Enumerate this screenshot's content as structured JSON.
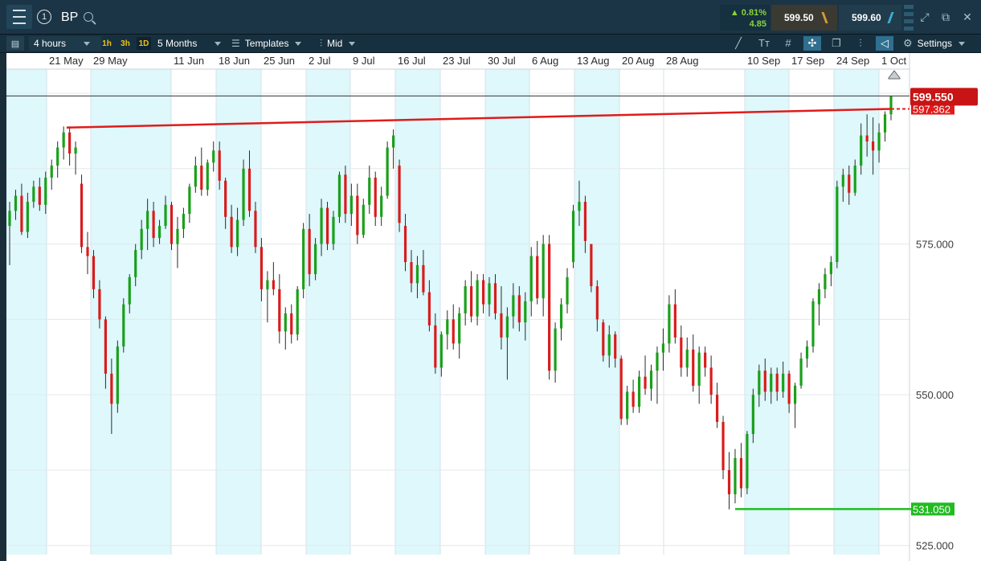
{
  "header": {
    "symbol": "BP",
    "instrument_count": "1",
    "change_pct": "▲ 0.81%",
    "change_abs": "4.85",
    "sell_price": "599.50",
    "buy_price": "599.60"
  },
  "toolbar": {
    "interval": "4 hours",
    "quick_intervals": [
      "1h",
      "3h",
      "1D"
    ],
    "range": "5 Months",
    "templates_label": "Templates",
    "price_mode": "Mid",
    "settings_label": "Settings"
  },
  "colors": {
    "up": "#1aa01a",
    "down": "#d91c1c",
    "band": "#def8fc",
    "topbar": "#1b3546"
  },
  "chart_data": {
    "type": "candlestick",
    "x_ticks": [
      "21 May",
      "29 May",
      "11 Jun",
      "18 Jun",
      "25 Jun",
      "2 Jul",
      "9 Jul",
      "16 Jul",
      "23 Jul",
      "30 Jul",
      "6 Aug",
      "13 Aug",
      "20 Aug",
      "28 Aug",
      "10 Sep",
      "17 Sep",
      "24 Sep",
      "1 Oct"
    ],
    "y_ticks": [
      575,
      550,
      525
    ],
    "y_tick_labels": [
      "575.000",
      "550.000",
      "525.000"
    ],
    "ylim": [
      523.5,
      604
    ],
    "current_price_label": "599.550",
    "resistance_label": "597.362",
    "support_label": "531.050",
    "resistance_line": {
      "from": {
        "x": "~18 May",
        "y": 594.3
      },
      "to": {
        "x": "1 Oct",
        "y": 597.4
      }
    },
    "support_line": {
      "from": "~7 Sep",
      "to": "1 Oct",
      "y": 531.05
    },
    "candles": [
      [
        578.0,
        582.0,
        571.5,
        580.5
      ],
      [
        580.5,
        584.0,
        579.0,
        583.0
      ],
      [
        583.0,
        585.0,
        576.5,
        577.0
      ],
      [
        577.0,
        583.5,
        576.0,
        582.0
      ],
      [
        582.0,
        585.5,
        581.0,
        584.5
      ],
      [
        584.5,
        586.0,
        580.5,
        581.5
      ],
      [
        581.5,
        587.0,
        580.0,
        586.0
      ],
      [
        586.0,
        589.0,
        584.0,
        588.0
      ],
      [
        588.0,
        592.0,
        586.0,
        591.0
      ],
      [
        591.0,
        594.5,
        589.0,
        593.5
      ],
      [
        593.5,
        594.5,
        588.0,
        590.0
      ],
      [
        590.0,
        592.0,
        586.5,
        591.0
      ],
      [
        585.0,
        586.5,
        573.5,
        574.5
      ],
      [
        574.5,
        577.0,
        570.0,
        573.0
      ],
      [
        573.0,
        574.0,
        566.0,
        567.5
      ],
      [
        567.5,
        569.0,
        561.0,
        562.5
      ],
      [
        562.5,
        563.0,
        551.0,
        553.5
      ],
      [
        553.5,
        556.0,
        543.5,
        548.5
      ],
      [
        548.5,
        559.0,
        547.0,
        558.0
      ],
      [
        558.0,
        566.0,
        557.0,
        565.0
      ],
      [
        565.0,
        570.0,
        563.5,
        569.5
      ],
      [
        569.5,
        575.0,
        568.0,
        574.0
      ],
      [
        574.0,
        579.0,
        572.5,
        577.5
      ],
      [
        577.5,
        582.5,
        574.0,
        580.5
      ],
      [
        580.5,
        582.0,
        574.5,
        576.0
      ],
      [
        576.0,
        579.0,
        575.0,
        578.0
      ],
      [
        578.0,
        583.0,
        577.5,
        581.5
      ],
      [
        581.5,
        582.0,
        574.0,
        575.0
      ],
      [
        575.0,
        579.5,
        571.0,
        577.5
      ],
      [
        577.5,
        581.0,
        576.0,
        580.0
      ],
      [
        580.0,
        585.0,
        578.5,
        584.5
      ],
      [
        584.5,
        589.5,
        583.5,
        588.0
      ],
      [
        588.0,
        591.0,
        583.0,
        584.0
      ],
      [
        584.0,
        589.0,
        583.0,
        588.5
      ],
      [
        588.5,
        592.0,
        587.0,
        590.5
      ],
      [
        590.5,
        592.0,
        584.0,
        585.5
      ],
      [
        585.5,
        586.0,
        577.5,
        579.5
      ],
      [
        579.5,
        581.5,
        573.5,
        574.5
      ],
      [
        574.5,
        581.0,
        573.0,
        579.0
      ],
      [
        579.0,
        589.0,
        578.0,
        587.5
      ],
      [
        587.5,
        590.5,
        579.5,
        580.5
      ],
      [
        580.5,
        582.0,
        573.5,
        574.5
      ],
      [
        574.5,
        576.0,
        565.5,
        567.5
      ],
      [
        567.5,
        570.5,
        562.0,
        569.0
      ],
      [
        569.0,
        572.0,
        566.5,
        567.5
      ],
      [
        567.5,
        570.0,
        558.5,
        560.5
      ],
      [
        560.5,
        564.5,
        557.5,
        563.5
      ],
      [
        563.5,
        565.0,
        558.5,
        560.0
      ],
      [
        560.0,
        568.0,
        559.0,
        567.5
      ],
      [
        567.5,
        578.5,
        566.0,
        577.5
      ],
      [
        577.5,
        580.0,
        568.0,
        570.0
      ],
      [
        570.0,
        576.0,
        569.0,
        575.0
      ],
      [
        575.0,
        582.5,
        573.0,
        581.0
      ],
      [
        581.0,
        582.0,
        574.0,
        575.0
      ],
      [
        575.0,
        580.5,
        574.0,
        579.5
      ],
      [
        579.5,
        587.0,
        578.5,
        586.5
      ],
      [
        586.5,
        588.0,
        578.5,
        580.0
      ],
      [
        580.0,
        585.0,
        578.0,
        583.0
      ],
      [
        583.0,
        585.0,
        575.0,
        576.5
      ],
      [
        576.5,
        582.5,
        576.0,
        581.5
      ],
      [
        581.5,
        588.0,
        580.0,
        586.0
      ],
      [
        586.0,
        587.0,
        578.0,
        579.5
      ],
      [
        579.5,
        584.5,
        578.0,
        583.0
      ],
      [
        583.0,
        592.0,
        582.5,
        591.0
      ],
      [
        591.0,
        594.0,
        587.5,
        593.0
      ],
      [
        588.0,
        589.0,
        577.0,
        578.5
      ],
      [
        578.0,
        580.0,
        570.5,
        572.0
      ],
      [
        572.0,
        574.0,
        567.0,
        568.5
      ],
      [
        568.5,
        573.0,
        566.0,
        571.5
      ],
      [
        571.5,
        574.0,
        566.5,
        567.0
      ],
      [
        567.0,
        569.0,
        560.5,
        561.5
      ],
      [
        561.5,
        563.5,
        553.5,
        554.5
      ],
      [
        554.5,
        560.5,
        553.0,
        560.0
      ],
      [
        560.0,
        564.0,
        557.5,
        562.5
      ],
      [
        562.5,
        565.0,
        557.5,
        558.5
      ],
      [
        558.5,
        564.5,
        556.0,
        563.5
      ],
      [
        563.5,
        569.0,
        561.5,
        568.0
      ],
      [
        568.0,
        570.5,
        562.0,
        563.0
      ],
      [
        563.0,
        570.0,
        561.5,
        569.0
      ],
      [
        569.0,
        570.0,
        563.5,
        565.0
      ],
      [
        565.0,
        569.5,
        563.0,
        568.5
      ],
      [
        568.5,
        570.0,
        562.5,
        563.5
      ],
      [
        563.5,
        568.0,
        557.5,
        559.5
      ],
      [
        559.5,
        564.5,
        552.5,
        563.0
      ],
      [
        563.0,
        568.5,
        561.0,
        566.5
      ],
      [
        566.5,
        568.0,
        560.5,
        562.0
      ],
      [
        562.0,
        567.0,
        559.0,
        565.5
      ],
      [
        565.5,
        574.5,
        563.0,
        573.0
      ],
      [
        573.0,
        575.5,
        565.0,
        566.0
      ],
      [
        566.0,
        576.5,
        563.0,
        575.0
      ],
      [
        575.0,
        576.5,
        552.5,
        554.0
      ],
      [
        554.0,
        562.0,
        552.0,
        561.0
      ],
      [
        561.0,
        566.0,
        559.0,
        565.0
      ],
      [
        565.0,
        571.0,
        563.5,
        569.5
      ],
      [
        572.0,
        581.5,
        571.0,
        580.5
      ],
      [
        580.5,
        585.5,
        578.0,
        582.0
      ],
      [
        582.0,
        583.0,
        573.5,
        575.5
      ],
      [
        575.0,
        570.0,
        567.0,
        568.0
      ],
      [
        568.0,
        569.0,
        560.5,
        562.5
      ],
      [
        562.0,
        562.5,
        555.5,
        556.5
      ],
      [
        556.5,
        561.5,
        554.5,
        560.0
      ],
      [
        560.0,
        560.5,
        554.5,
        556.0
      ],
      [
        556.0,
        556.5,
        545.0,
        546.0
      ],
      [
        546.0,
        551.5,
        545.0,
        550.5
      ],
      [
        550.5,
        552.5,
        547.0,
        548.0
      ],
      [
        548.0,
        554.0,
        547.0,
        553.0
      ],
      [
        553.0,
        556.5,
        550.0,
        551.0
      ],
      [
        551.0,
        555.0,
        549.0,
        554.0
      ],
      [
        554.0,
        558.0,
        548.5,
        557.0
      ],
      [
        557.0,
        561.0,
        554.0,
        558.5
      ],
      [
        558.5,
        566.5,
        557.0,
        565.0
      ],
      [
        565.0,
        567.5,
        558.5,
        559.5
      ],
      [
        559.5,
        561.5,
        553.0,
        554.5
      ],
      [
        554.5,
        559.5,
        553.0,
        557.5
      ],
      [
        557.5,
        560.0,
        550.5,
        551.5
      ],
      [
        551.5,
        558.0,
        548.5,
        557.0
      ],
      [
        557.0,
        558.0,
        553.0,
        554.5
      ],
      [
        554.5,
        556.5,
        548.5,
        550.0
      ],
      [
        550.0,
        552.0,
        544.5,
        545.5
      ],
      [
        545.5,
        546.5,
        536.0,
        537.5
      ],
      [
        537.5,
        540.5,
        531.0,
        533.5
      ],
      [
        533.5,
        541.0,
        532.0,
        539.5
      ],
      [
        539.5,
        542.0,
        533.0,
        534.5
      ],
      [
        534.5,
        544.0,
        533.5,
        543.5
      ],
      [
        543.5,
        551.0,
        542.0,
        550.0
      ],
      [
        550.0,
        555.0,
        548.0,
        554.0
      ],
      [
        554.0,
        556.0,
        549.0,
        550.5
      ],
      [
        550.5,
        554.5,
        548.5,
        553.5
      ],
      [
        553.5,
        554.5,
        549.0,
        550.5
      ],
      [
        550.5,
        555.5,
        549.5,
        553.5
      ],
      [
        553.5,
        554.0,
        547.0,
        548.5
      ],
      [
        548.5,
        552.0,
        544.5,
        551.5
      ],
      [
        551.5,
        557.0,
        551.0,
        556.0
      ],
      [
        556.0,
        559.0,
        554.5,
        558.0
      ],
      [
        558.0,
        566.0,
        557.0,
        565.5
      ],
      [
        565.0,
        568.5,
        561.5,
        567.5
      ],
      [
        567.5,
        571.0,
        566.0,
        570.0
      ],
      [
        570.0,
        573.0,
        568.0,
        572.0
      ],
      [
        572.0,
        585.5,
        571.0,
        584.5
      ],
      [
        584.5,
        587.5,
        582.0,
        586.5
      ],
      [
        586.5,
        588.0,
        581.5,
        583.5
      ],
      [
        583.5,
        589.0,
        583.0,
        588.0
      ],
      [
        588.0,
        595.0,
        586.5,
        593.0
      ],
      [
        593.0,
        596.5,
        589.5,
        592.0
      ],
      [
        592.0,
        596.0,
        586.5,
        590.5
      ],
      [
        590.5,
        595.0,
        588.5,
        593.5
      ],
      [
        593.5,
        597.0,
        592.0,
        596.5
      ],
      [
        596.5,
        599.5,
        595.5,
        599.5
      ]
    ]
  }
}
